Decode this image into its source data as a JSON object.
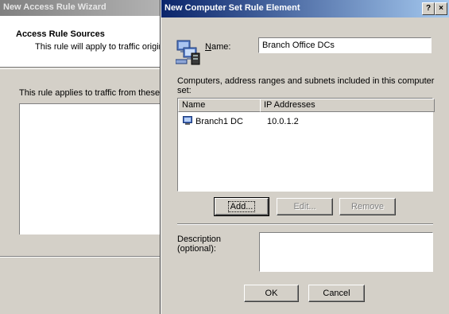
{
  "background_wizard": {
    "title": "New Access Rule Wizard",
    "header_title": "Access Rule Sources",
    "header_subtitle": "This rule will apply to traffic originati",
    "body_text": "This rule applies to traffic from these sou"
  },
  "dialog": {
    "title": "New Computer Set Rule Element",
    "help_button": "?",
    "close_button": "×",
    "name_label_prefix": "",
    "name_label_underlined": "N",
    "name_label_rest": "ame:",
    "name_value": "Branch Office DCs",
    "list_description": "Computers, address ranges and subnets included in this computer set:",
    "columns": [
      "Name",
      "IP Addresses"
    ],
    "rows": [
      {
        "name": "Branch1 DC",
        "ip": "10.0.1.2",
        "icon": "computer-icon"
      }
    ],
    "add_button": "Add...",
    "edit_button": "Edit...",
    "remove_button": "Remove",
    "description_label": "Description (optional):",
    "description_value": "",
    "ok_button": "OK",
    "cancel_button": "Cancel"
  }
}
